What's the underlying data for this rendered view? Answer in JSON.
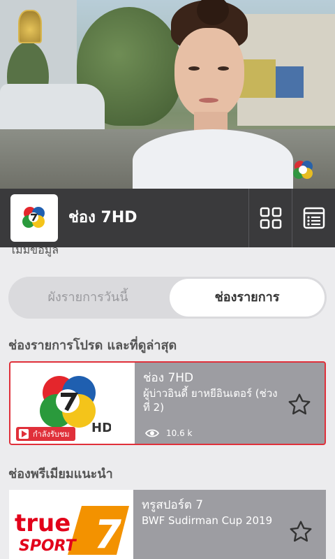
{
  "channel_header": {
    "title": "ช่อง 7HD",
    "grid_icon": "grid-view-icon",
    "list_icon": "program-list-icon",
    "header_bg": "#3a3a3c"
  },
  "partial_text": "ไม่มีข้อมูล",
  "tabs": [
    {
      "label": "ผังรายการวันนี้",
      "selected": false
    },
    {
      "label": "ช่องรายการ",
      "selected": true
    }
  ],
  "sections": {
    "favorites_title": "ช่องรายการโปรด และที่ดูล่าสุด",
    "premium_title": "ช่องพรีเมียมแนะนำ"
  },
  "favorite_card": {
    "channel": "ช่อง 7HD",
    "program": "ผู้บ่าวอินดี้ ยาหยีอินเตอร์ (ช่วงที่ 2)",
    "views": "10.6 k",
    "live_label": "กำลังรับชม",
    "accent": "#e0303a"
  },
  "premium_card": {
    "channel": "ทรูสปอร์ต 7",
    "program": "BWF Sudirman Cup 2019",
    "logo_text_1": "true",
    "logo_text_2": "SPORT",
    "logo_number": "7",
    "brand_red": "#e2001a",
    "brand_orange": "#f39200"
  }
}
